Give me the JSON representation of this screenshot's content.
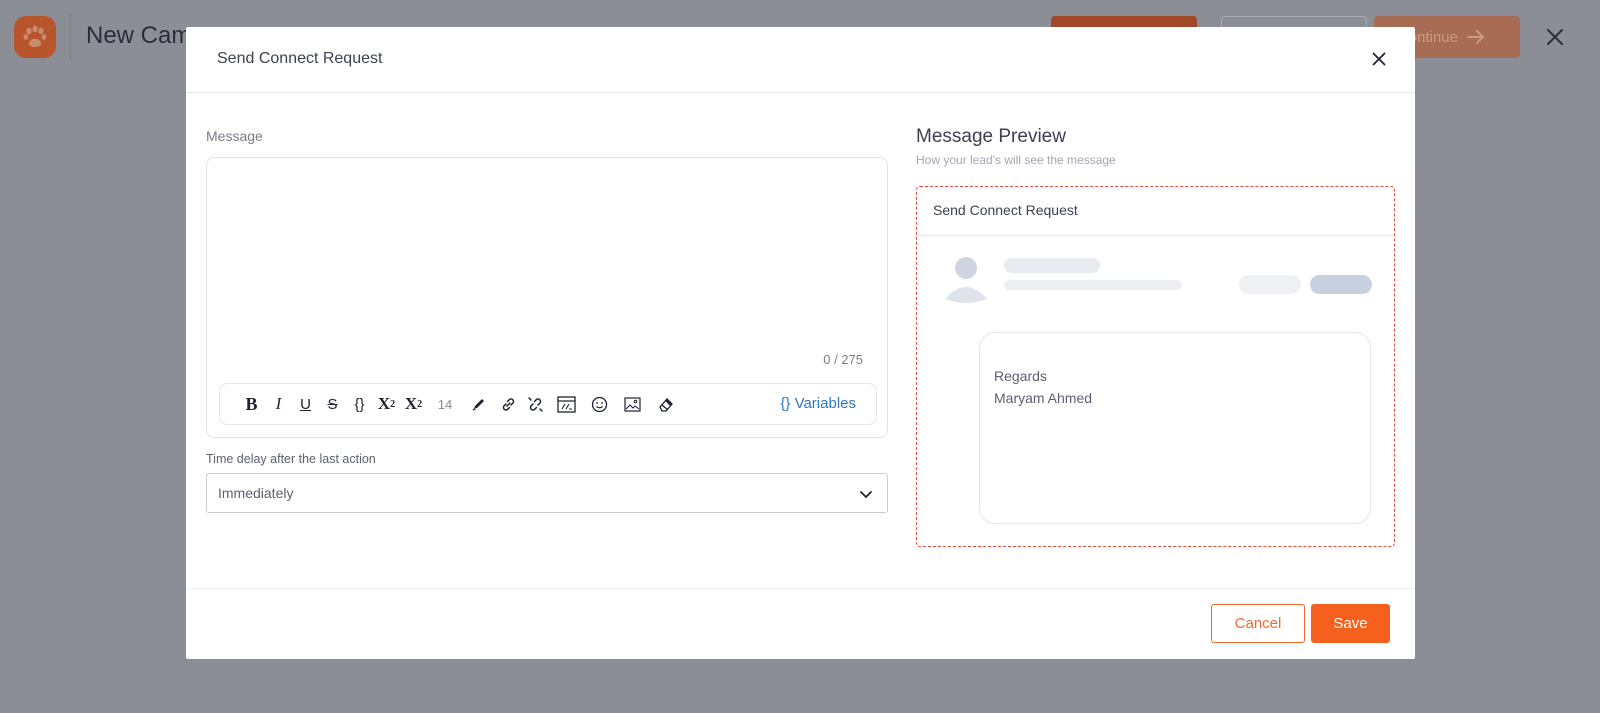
{
  "background": {
    "page_title": "New Cam",
    "continue_label": "ontinue",
    "icons": {
      "logo": "paw-icon",
      "continue": "arrow-right-icon",
      "close": "close-icon"
    }
  },
  "modal": {
    "title": "Send Connect Request",
    "editor": {
      "label": "Message",
      "char_count": "0 / 275",
      "toolbar": {
        "font_size": "14",
        "variables_label": "{} Variables",
        "tools": [
          "bold-icon",
          "italic-icon",
          "underline-icon",
          "strikethrough-icon",
          "braces-icon",
          "superscript-icon",
          "subscript-icon",
          "font-size",
          "pen-icon",
          "link-icon",
          "unlink-icon",
          "html-icon",
          "emoji-icon",
          "image-icon",
          "eraser-icon"
        ]
      }
    },
    "delay": {
      "label": "Time delay after the last action",
      "value": "Immediately"
    },
    "preview": {
      "title": "Message Preview",
      "subtitle": "How your lead's will see the message",
      "card_title": "Send Connect Request",
      "message_lines": [
        "Regards",
        "Maryam Ahmed"
      ]
    },
    "footer": {
      "cancel_label": "Cancel",
      "save_label": "Save"
    }
  },
  "colors": {
    "accent": "#f5601d",
    "preview_border": "#e8473b",
    "link": "#2f78c4",
    "overlay": "#8b8e94"
  }
}
